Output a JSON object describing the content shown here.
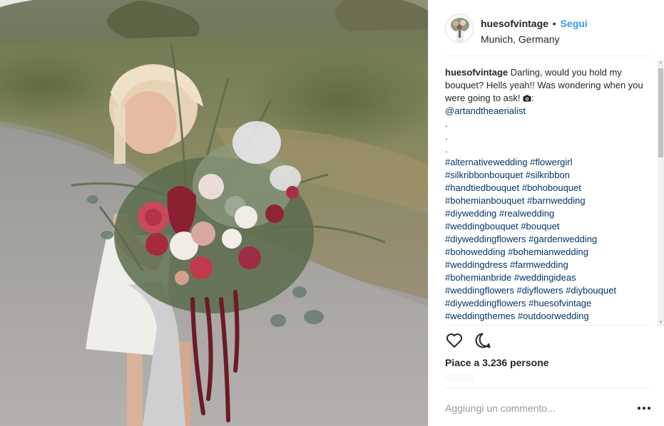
{
  "post": {
    "photo_description_icon": "bouquet-photo",
    "author": {
      "username": "huesofvintage",
      "separator": "•",
      "follow_label": "Segui",
      "location": "Munich, Germany"
    },
    "caption": {
      "username": "huesofvintage",
      "text": "Darling, would you hold my bouquet? Hells yeah!! Was wondering when you were going to ask! ",
      "camera_icon": "camera-icon",
      "colon": ":",
      "mention": "@artandtheaerialist",
      "dots": [
        ".",
        ".",
        "."
      ],
      "hashtag_lines": [
        [
          "#alternativewedding",
          "#flowergirl"
        ],
        [
          "#silkribbonbouquet",
          "#silkribbon"
        ],
        [
          "#handtiedbouquet",
          "#bohobouquet"
        ],
        [
          "#bohemianbouquet",
          "#barnwedding"
        ],
        [
          "#diywedding",
          "#realwedding"
        ],
        [
          "#weddingbouquet",
          "#bouquet"
        ],
        [
          "#diyweddingflowers",
          "#gardenwedding"
        ],
        [
          "#bohowedding",
          "#bohemianwedding"
        ],
        [
          "#weddingdress",
          "#farmwedding"
        ],
        [
          "#bohemianbride",
          "#weddingideas"
        ],
        [
          "#weddingflowers",
          "#diyflowers",
          "#diybouquet"
        ],
        [
          "#diyweddingflowers",
          "#huesofvintage"
        ],
        [
          "#weddingthemes",
          "#outdoorwedding"
        ]
      ]
    },
    "actions": {
      "like_icon": "heart-icon",
      "comment_icon": "comment-icon"
    },
    "likes_text": "Piace a 3.236 persone",
    "comment_placeholder": "Aggiungi un commento...",
    "more_icon": "more-options-icon",
    "colors": {
      "link_blue": "#3897f0",
      "hashtag": "#003569",
      "text": "#262626",
      "placeholder": "#999999",
      "divider": "#efefef"
    }
  }
}
